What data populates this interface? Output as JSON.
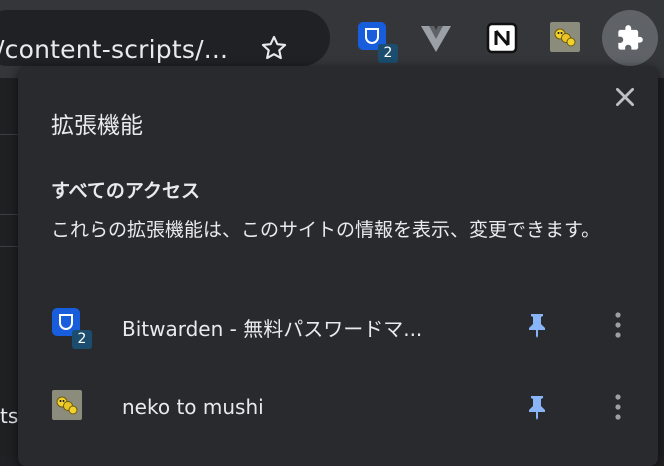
{
  "toolbar": {
    "url_text": "n/content-scripts/...",
    "bitwarden_badge": "2",
    "accent": "#8ab4f8"
  },
  "background_page": {
    "fragment_text": "ts"
  },
  "popup": {
    "title": "拡張機能",
    "section_title": "すべてのアクセス",
    "description": "これらの拡張機能は、このサイトの情報を表示、変更できます。",
    "extensions": [
      {
        "name": "Bitwarden - 無料パスワードマ...",
        "badge": "2",
        "icon": "bitwarden-icon",
        "pinned": true
      },
      {
        "name": "neko to mushi",
        "badge": "",
        "icon": "neko-to-mushi-icon",
        "pinned": true
      }
    ]
  }
}
